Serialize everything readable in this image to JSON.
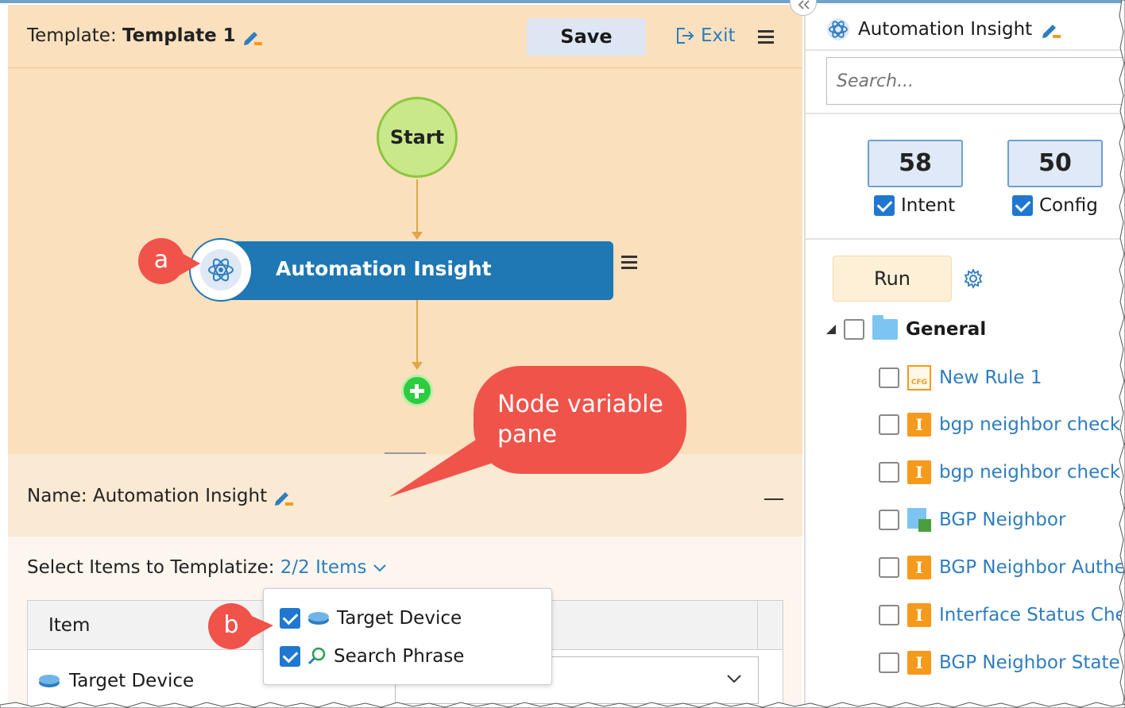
{
  "toolbar": {
    "template_prefix": "Template:",
    "template_name": "Template 1",
    "save_label": "Save",
    "exit_label": "Exit"
  },
  "canvas": {
    "start_label": "Start",
    "node_label": "Automation Insight"
  },
  "annotations": {
    "callout_a": "a",
    "callout_b": "b",
    "note_line1": "Node variable",
    "note_line2": "pane"
  },
  "variable_pane": {
    "name_prefix": "Name:",
    "name_value": "Automation Insight",
    "select_label": "Select Items to Templatize:",
    "select_count": "2/2 Items",
    "table_header_item": "Item",
    "row_item_label": "Target Device",
    "dropdown_items": [
      {
        "label": "Target Device",
        "checked": true,
        "icon": "router-icon"
      },
      {
        "label": "Search Phrase",
        "checked": true,
        "icon": "search-phrase-icon"
      }
    ]
  },
  "right_panel": {
    "title": "Automation Insight",
    "search_placeholder": "Search...",
    "intent_count": "58",
    "intent_label": "Intent",
    "config_count": "50",
    "config_label": "Config",
    "run_label": "Run",
    "folder_label": "General",
    "rules": [
      {
        "label": "New Rule 1",
        "icon": "cfg-file-icon"
      },
      {
        "label": "bgp neighbor check",
        "icon": "intent-icon"
      },
      {
        "label": "bgp neighbor check",
        "icon": "intent-icon"
      },
      {
        "label": "BGP Neighbor",
        "icon": "intent-table-icon"
      },
      {
        "label": "BGP Neighbor Authe",
        "icon": "intent-icon"
      },
      {
        "label": "Interface Status Che",
        "icon": "intent-icon"
      },
      {
        "label": "BGP Neighbor State",
        "icon": "intent-icon"
      }
    ]
  },
  "colors": {
    "canvas_bg": "#fae0bd",
    "node_blue": "#1f77b4",
    "start_green": "#c9e88a",
    "callout_red": "#f0534a",
    "link_blue": "#2e7dbf",
    "intent_orange": "#f59a1b"
  }
}
